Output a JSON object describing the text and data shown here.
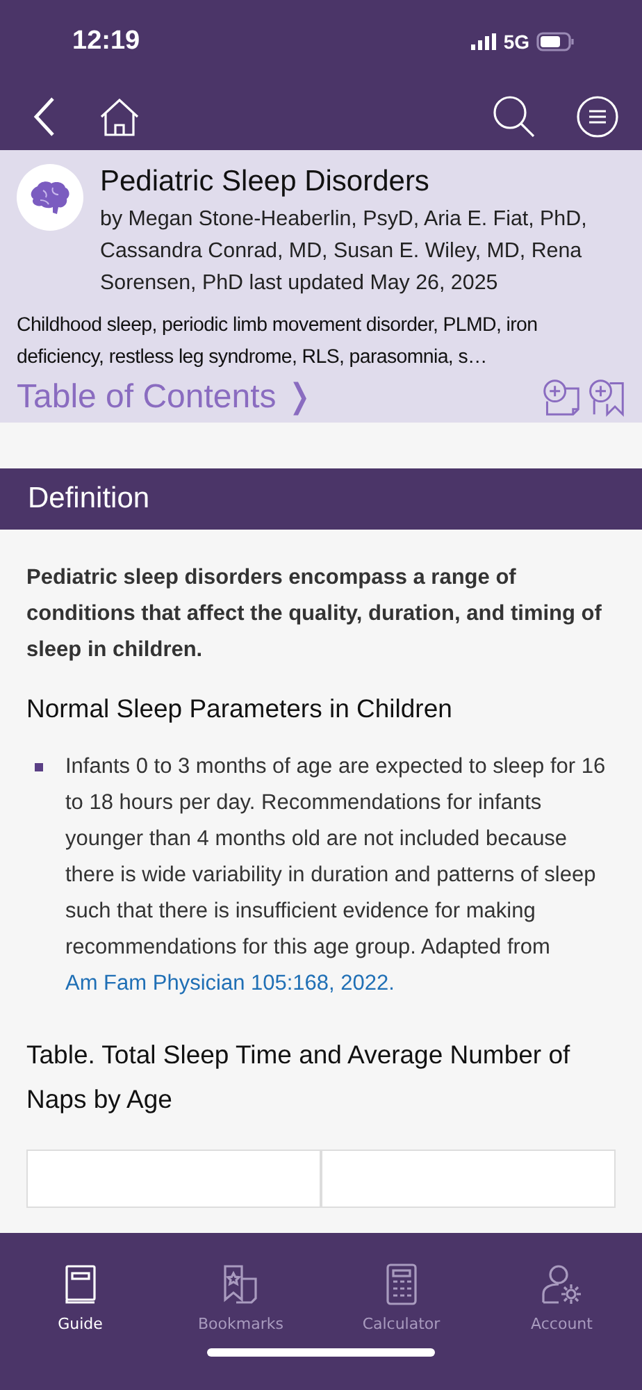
{
  "status_bar": {
    "time": "12:19",
    "network": "5G"
  },
  "nav": {
    "buttons": [
      {
        "kind": "back"
      },
      {
        "kind": "home"
      },
      {
        "kind": "search"
      },
      {
        "kind": "menu"
      }
    ]
  },
  "header": {
    "title": "Pediatric Sleep Disorders",
    "byline": "by Megan Stone-Heaberlin, PsyD, Aria E. Fiat, PhD, Cassandra Conrad, MD, Susan E. Wiley, MD, Rena Sorensen, PhD last updated May 26, 2025",
    "keywords": "Childhood sleep, periodic limb movement disorder, PLMD, iron deficiency, restless leg syndrome, RLS, parasomnia, s…",
    "toc_link": "Table of Contents ❭"
  },
  "section": {
    "title": "Definition",
    "lead": "Pediatric sleep disorders encompass a range of conditions that affect the quality, duration, and timing of sleep in children.",
    "subheading": "Normal Sleep Parameters in Children",
    "bullets": [
      {
        "text": "Infants 0 to 3 months of age are expected to sleep for 16 to 18 hours per day. Recommendations for infants younger than 4 months old are not included because there is wide variability in duration and patterns of sleep such that there is insufficient evidence for making recommendations for this age group. Adapted from ",
        "link": "Am Fam Physician 105:168, 2022."
      }
    ],
    "table_title": "Table. Total Sleep Time and Average Number of Naps by Age"
  },
  "tab_bar": [
    {
      "label": "Guide",
      "kind": "guide",
      "selected": true
    },
    {
      "label": "Bookmarks",
      "kind": "bookmarks",
      "selected": false
    },
    {
      "label": "Calculator",
      "kind": "calculator",
      "selected": false
    },
    {
      "label": "Account",
      "kind": "account",
      "selected": false
    }
  ]
}
